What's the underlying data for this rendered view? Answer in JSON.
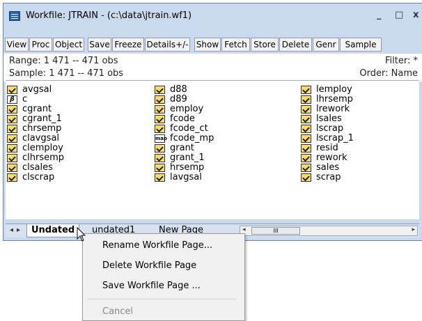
{
  "window": {
    "title": "Workfile: JTRAIN - (c:\\data\\jtrain.wf1)",
    "minimize_glyph": "_",
    "maximize_glyph": "□",
    "close_glyph": "x"
  },
  "toolbar": {
    "buttons": [
      "View",
      "Proc",
      "Object",
      "Save",
      "Freeze",
      "Details+/-",
      "Show",
      "Fetch",
      "Store",
      "Delete",
      "Genr",
      "Sample"
    ]
  },
  "info": {
    "range_label": "Range:  1 471  --  471 obs",
    "sample_label": "Sample: 1 471  --  471 obs",
    "filter_label": "Filter: *",
    "order_label": "Order: Name"
  },
  "objects": {
    "col1": [
      {
        "name": "avgsal",
        "icon": "series-icon"
      },
      {
        "name": "c",
        "icon": "coefficient-icon"
      },
      {
        "name": "cgrant",
        "icon": "series-icon"
      },
      {
        "name": "cgrant_1",
        "icon": "series-icon"
      },
      {
        "name": "chrsemp",
        "icon": "series-icon"
      },
      {
        "name": "clavgsal",
        "icon": "series-icon"
      },
      {
        "name": "clemploy",
        "icon": "series-icon"
      },
      {
        "name": "clhrsemp",
        "icon": "series-icon"
      },
      {
        "name": "clsales",
        "icon": "series-icon"
      },
      {
        "name": "clscrap",
        "icon": "series-icon"
      }
    ],
    "col2": [
      {
        "name": "d88",
        "icon": "series-icon"
      },
      {
        "name": "d89",
        "icon": "series-icon"
      },
      {
        "name": "employ",
        "icon": "series-icon"
      },
      {
        "name": "fcode",
        "icon": "series-icon"
      },
      {
        "name": "fcode_ct",
        "icon": "series-icon"
      },
      {
        "name": "fcode_mp",
        "icon": "valmap-icon"
      },
      {
        "name": "grant",
        "icon": "series-icon"
      },
      {
        "name": "grant_1",
        "icon": "series-icon"
      },
      {
        "name": "hrsemp",
        "icon": "series-icon"
      },
      {
        "name": "lavgsal",
        "icon": "series-icon"
      }
    ],
    "col3": [
      {
        "name": "lemploy",
        "icon": "series-icon"
      },
      {
        "name": "lhrsemp",
        "icon": "series-icon"
      },
      {
        "name": "lrework",
        "icon": "series-icon"
      },
      {
        "name": "lsales",
        "icon": "series-icon"
      },
      {
        "name": "lscrap",
        "icon": "series-icon"
      },
      {
        "name": "lscrap_1",
        "icon": "series-icon"
      },
      {
        "name": "resid",
        "icon": "series-icon"
      },
      {
        "name": "rework",
        "icon": "series-icon"
      },
      {
        "name": "sales",
        "icon": "series-icon"
      },
      {
        "name": "scrap",
        "icon": "series-icon"
      }
    ]
  },
  "tabs": [
    "Undated",
    "undated1",
    "New Page"
  ],
  "active_tab": "Undated",
  "context_menu": {
    "items": [
      "Rename Workfile Page...",
      "Delete Workfile Page",
      "Save Workfile Page ..."
    ],
    "cancel": "Cancel"
  },
  "scroll_thumb_glyph": "III"
}
